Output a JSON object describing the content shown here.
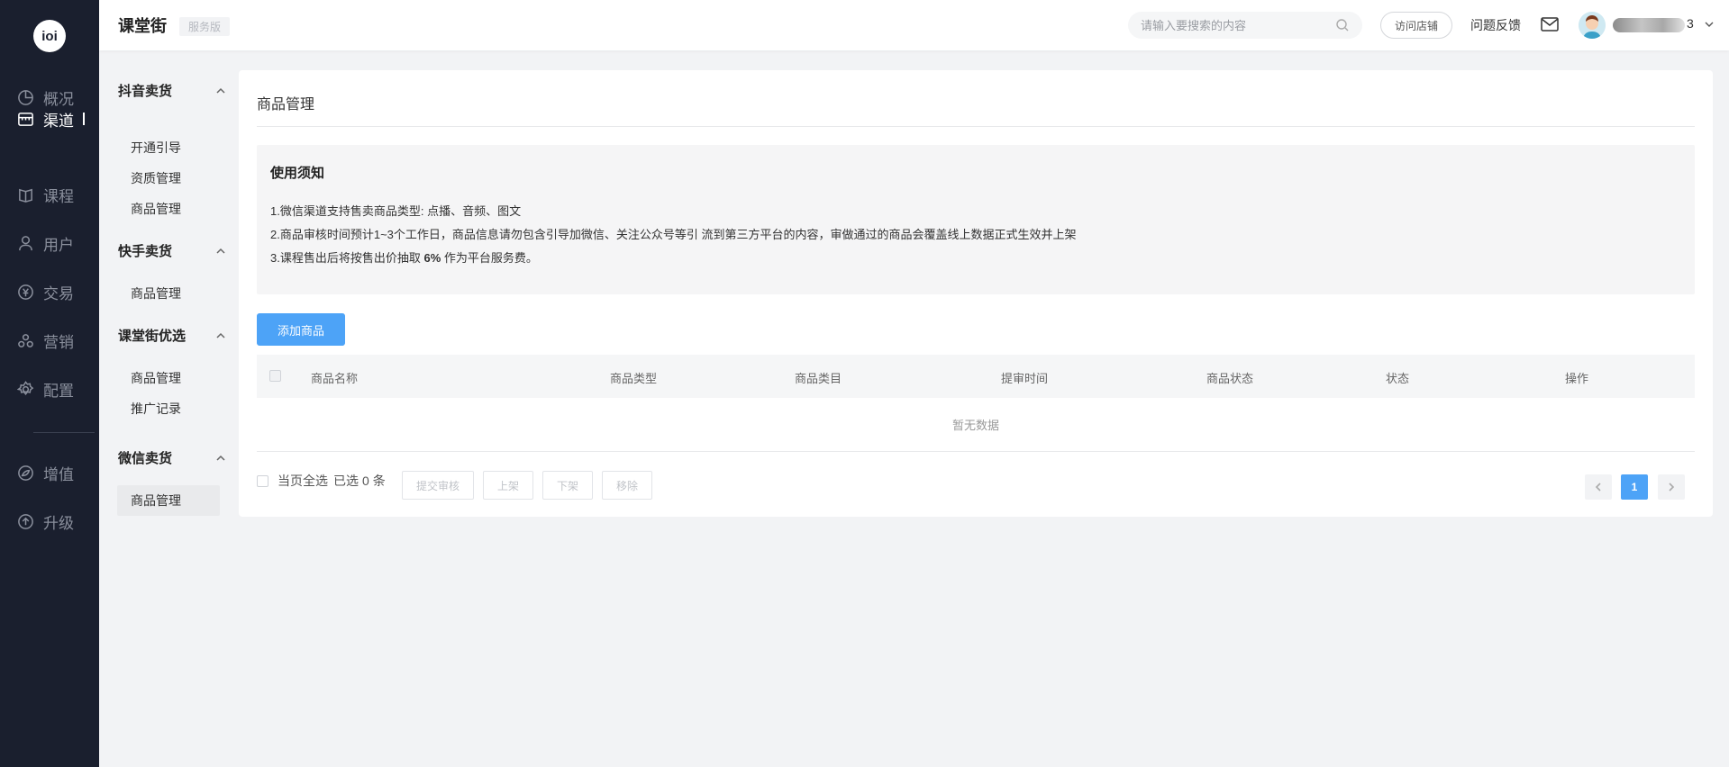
{
  "rail": {
    "logo": "ioi",
    "items": [
      {
        "label": "概况",
        "icon": "pie-chart-icon"
      },
      {
        "label": "渠道",
        "icon": "store-icon"
      },
      {
        "label": "课程",
        "icon": "book-icon"
      },
      {
        "label": "用户",
        "icon": "user-icon"
      },
      {
        "label": "交易",
        "icon": "yen-circle-icon"
      },
      {
        "label": "营销",
        "icon": "gift-icon"
      },
      {
        "label": "配置",
        "icon": "gear-icon"
      },
      {
        "label": "增值",
        "icon": "leaf-icon"
      },
      {
        "label": "升级",
        "icon": "upgrade-icon"
      }
    ]
  },
  "header": {
    "brand": "课堂街",
    "brand_tag": "服务版",
    "search_placeholder": "请输入要搜索的内容",
    "visit_store": "访问店铺",
    "feedback": "问题反馈",
    "username_suffix": "3"
  },
  "subnav": {
    "groups": [
      {
        "title": "抖音卖货",
        "items": [
          "开通引导",
          "资质管理",
          "商品管理"
        ]
      },
      {
        "title": "快手卖货",
        "items": [
          "商品管理"
        ]
      },
      {
        "title": "课堂街优选",
        "items": [
          "商品管理",
          "推广记录"
        ]
      },
      {
        "title": "微信卖货",
        "items": [
          "商品管理"
        ]
      }
    ]
  },
  "main": {
    "title": "商品管理",
    "notice": {
      "title": "使用须知",
      "line1": "1.微信渠道支持售卖商品类型: 点播、音频、图文",
      "line2": "2.商品审核时间预计1~3个工作日，商品信息请勿包含引导加微信、关注公众号等引 流到第三方平台的内容，审做通过的商品会覆盖线上数据正式生效并上架",
      "line3_pre": "3.课程售出后将按售出价抽取 ",
      "line3_bold": "6%",
      "line3_post": " 作为平台服务费。"
    },
    "add_button": "添加商品",
    "columns": [
      "商品名称",
      "商品类型",
      "商品类目",
      "提审时间",
      "商品状态",
      "状态",
      "操作"
    ],
    "empty_text": "暂无数据",
    "footer": {
      "select_all": "当页全选",
      "selected_pre": "已选",
      "selected_count": "0",
      "selected_post": "条",
      "btn_submit": "提交审核",
      "btn_on": "上架",
      "btn_off": "下架",
      "btn_remove": "移除"
    },
    "pagination": {
      "current": "1"
    }
  },
  "colors": {
    "accent": "#4da3f7",
    "rail_bg": "#1a1f2e"
  }
}
